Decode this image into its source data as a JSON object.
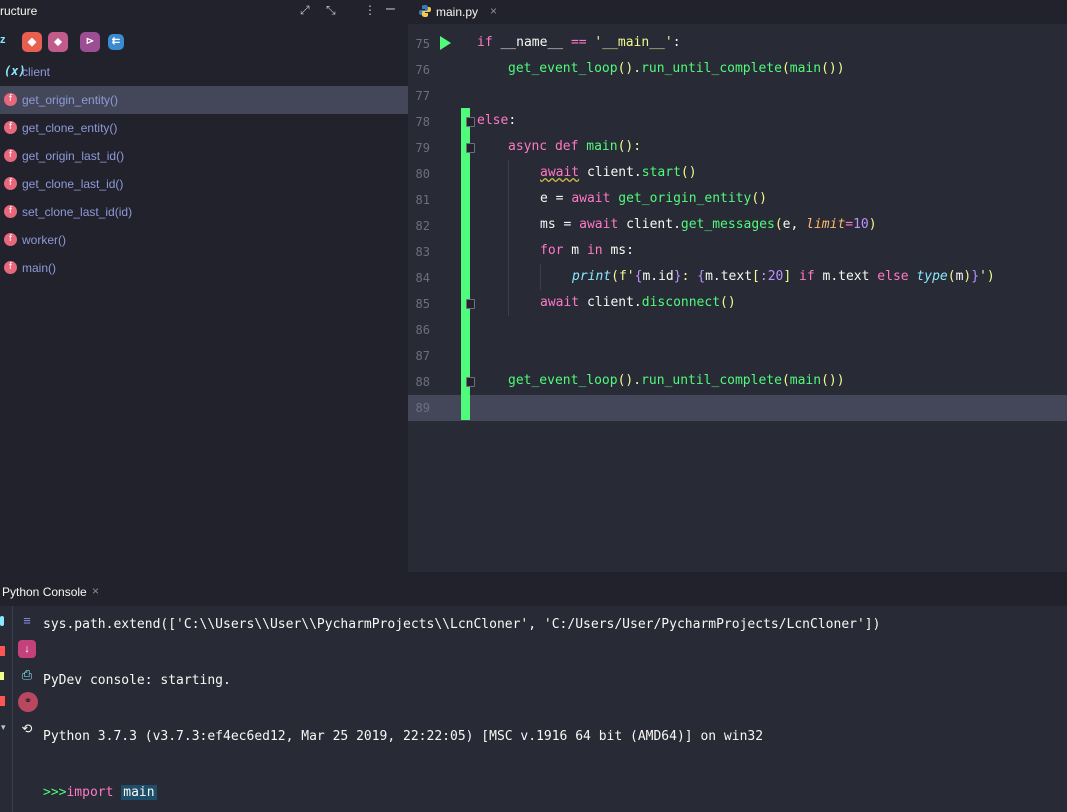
{
  "structure": {
    "title": "ructure",
    "header_icons": [
      "expand-icon",
      "collapse-icon",
      "more-vert-icon",
      "minimize-icon"
    ],
    "toolbar_letter": "z",
    "items": [
      {
        "label": "client",
        "kind": "variable",
        "badge": "(x)"
      },
      {
        "label": "get_origin_entity()",
        "kind": "function",
        "badge": "f",
        "selected": true
      },
      {
        "label": "get_clone_entity()",
        "kind": "function",
        "badge": "f"
      },
      {
        "label": "get_origin_last_id()",
        "kind": "function",
        "badge": "f"
      },
      {
        "label": "get_clone_last_id()",
        "kind": "function",
        "badge": "f"
      },
      {
        "label": "set_clone_last_id(id)",
        "kind": "function",
        "badge": "f"
      },
      {
        "label": "worker()",
        "kind": "function",
        "badge": "f"
      },
      {
        "label": "main()",
        "kind": "function",
        "badge": "f"
      }
    ]
  },
  "editor": {
    "tab": {
      "label": "main.py",
      "close": "×"
    },
    "line_numbers": [
      "75",
      "76",
      "77",
      "78",
      "79",
      "80",
      "81",
      "82",
      "83",
      "84",
      "85",
      "86",
      "87",
      "88",
      "89"
    ],
    "code": {
      "l75": {
        "kw": "if",
        "a": " __name__ ",
        "op": "==",
        "b": " ",
        "str": "'__main__'",
        "c": ":"
      },
      "l76": {
        "fn1": "get_event_loop",
        "p1": "().",
        "fn2": "run_until_complete",
        "p2": "(",
        "fn3": "main",
        "p3": "())"
      },
      "l78": {
        "kw": "else",
        "c": ":"
      },
      "l79": {
        "kw1": "async",
        "kw2": " def ",
        "fn": "main",
        "rest": "():"
      },
      "l80": {
        "kw": "await",
        "a": " client.",
        "fn": "start",
        "p": "()"
      },
      "l81": {
        "a": "e = ",
        "kw": "await",
        "b": " ",
        "fn": "get_origin_entity",
        "p": "()"
      },
      "l82": {
        "a": "ms = ",
        "kw": "await",
        "b": " client.",
        "fn": "get_messages",
        "p1": "(",
        "c": "e, ",
        "arg": "limit",
        "eq": "=",
        "num": "10",
        "p2": ")"
      },
      "l83": {
        "kw1": "for",
        "a": " m ",
        "kw2": "in",
        "b": " ms:"
      },
      "l84": {
        "fn": "print",
        "p1": "(",
        "pre": "f'",
        "b1": "{",
        "x1": "m.id",
        "b2": "}",
        "colon": ": ",
        "b3": "{",
        "x2": "m.text",
        "sl1": "[",
        "sln": ":20",
        "sl2": "]",
        "x3": " ",
        "kwif": "if",
        "x4": " m.text ",
        "kwelse": "else",
        "x5": " ",
        "ty": "type",
        "tp1": "(",
        "tm": "m",
        "tp2": ")",
        "b4": "}",
        "post": "'",
        "p2": ")"
      },
      "l85": {
        "kw": "await",
        "a": " client.",
        "fn": "disconnect",
        "p": "()"
      },
      "l88": {
        "fn1": "get_event_loop",
        "p1": "().",
        "fn2": "run_until_complete",
        "p2": "(",
        "fn3": "main",
        "p3": "())"
      }
    }
  },
  "console": {
    "tab_label": "Python Console",
    "tab_close": "×",
    "lines": [
      "sys.path.extend(['C:\\\\Users\\\\User\\\\PycharmProjects\\\\LcnCloner', 'C:/Users/User/PycharmProjects/LcnCloner'])",
      "PyDev console: starting.",
      "Python 3.7.3 (v3.7.3:ef4ec6ed12, Mar 25 2019, 22:22:05) [MSC v.1916 64 bit (AMD64)] on win32"
    ],
    "prompt": ">>>",
    "input_kw": "import",
    "input_word": "main"
  },
  "colors": {
    "background": "#282a36",
    "panel": "#21222c",
    "current_line": "#44475a",
    "keyword": "#ff79c6",
    "function": "#50fa7b",
    "string": "#f1fa8c",
    "number": "#bd93f9",
    "vcs_added": "#50fa7b"
  }
}
